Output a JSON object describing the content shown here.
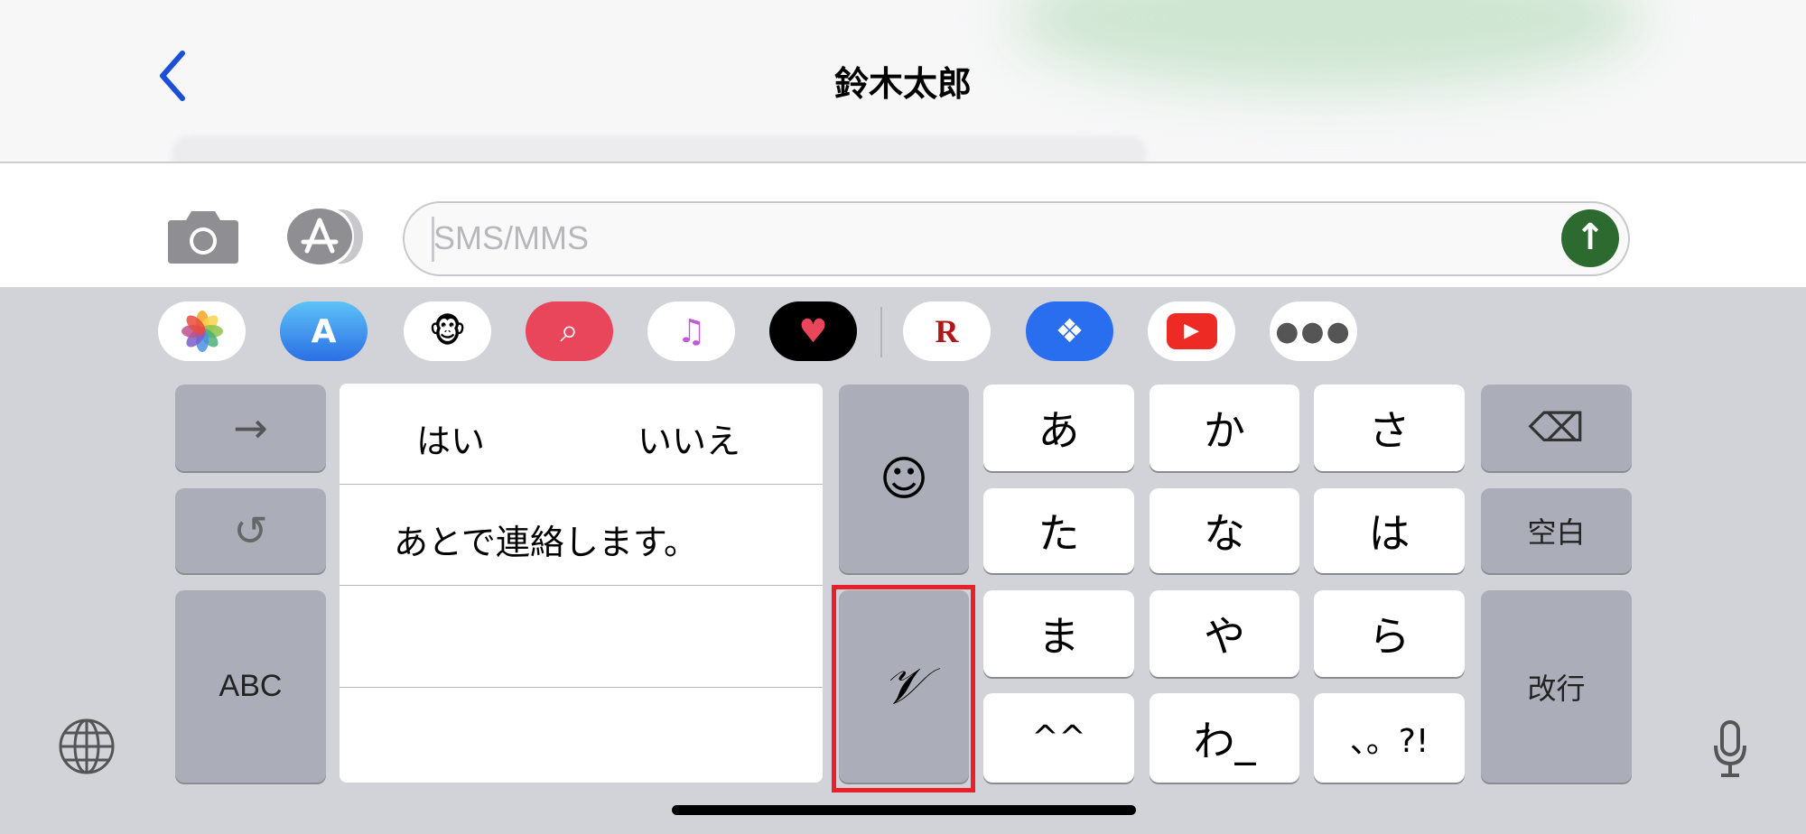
{
  "header": {
    "title": "鈴木太郎",
    "back_icon": "chevron-left-icon",
    "back_color": "#1c4fd8"
  },
  "compose": {
    "placeholder": "SMS/MMS",
    "camera_icon": "camera-icon",
    "apps_icon": "app-store-icon",
    "send_icon": "arrow-up-icon",
    "send_color": "#2d6a30"
  },
  "app_drawer": [
    "photos",
    "app-store",
    "animoji",
    "search-images",
    "music",
    "digital-touch",
    "rakuten",
    "dropbox",
    "youtube",
    "more"
  ],
  "candidates": {
    "row1": [
      "はい",
      "いいえ"
    ],
    "row2": "あとで連絡します。"
  },
  "keys": {
    "next": "→",
    "undo": "↺",
    "abc": "ABC",
    "emoji": "☺",
    "handwrite": "𝒱",
    "kana": [
      "あ",
      "か",
      "さ",
      "た",
      "な",
      "は",
      "ま",
      "や",
      "ら",
      "^^",
      "わ_",
      "、。?!"
    ],
    "backspace": "⌫",
    "space": "空白",
    "return": "改行"
  },
  "highlight_color": "#e8202a"
}
